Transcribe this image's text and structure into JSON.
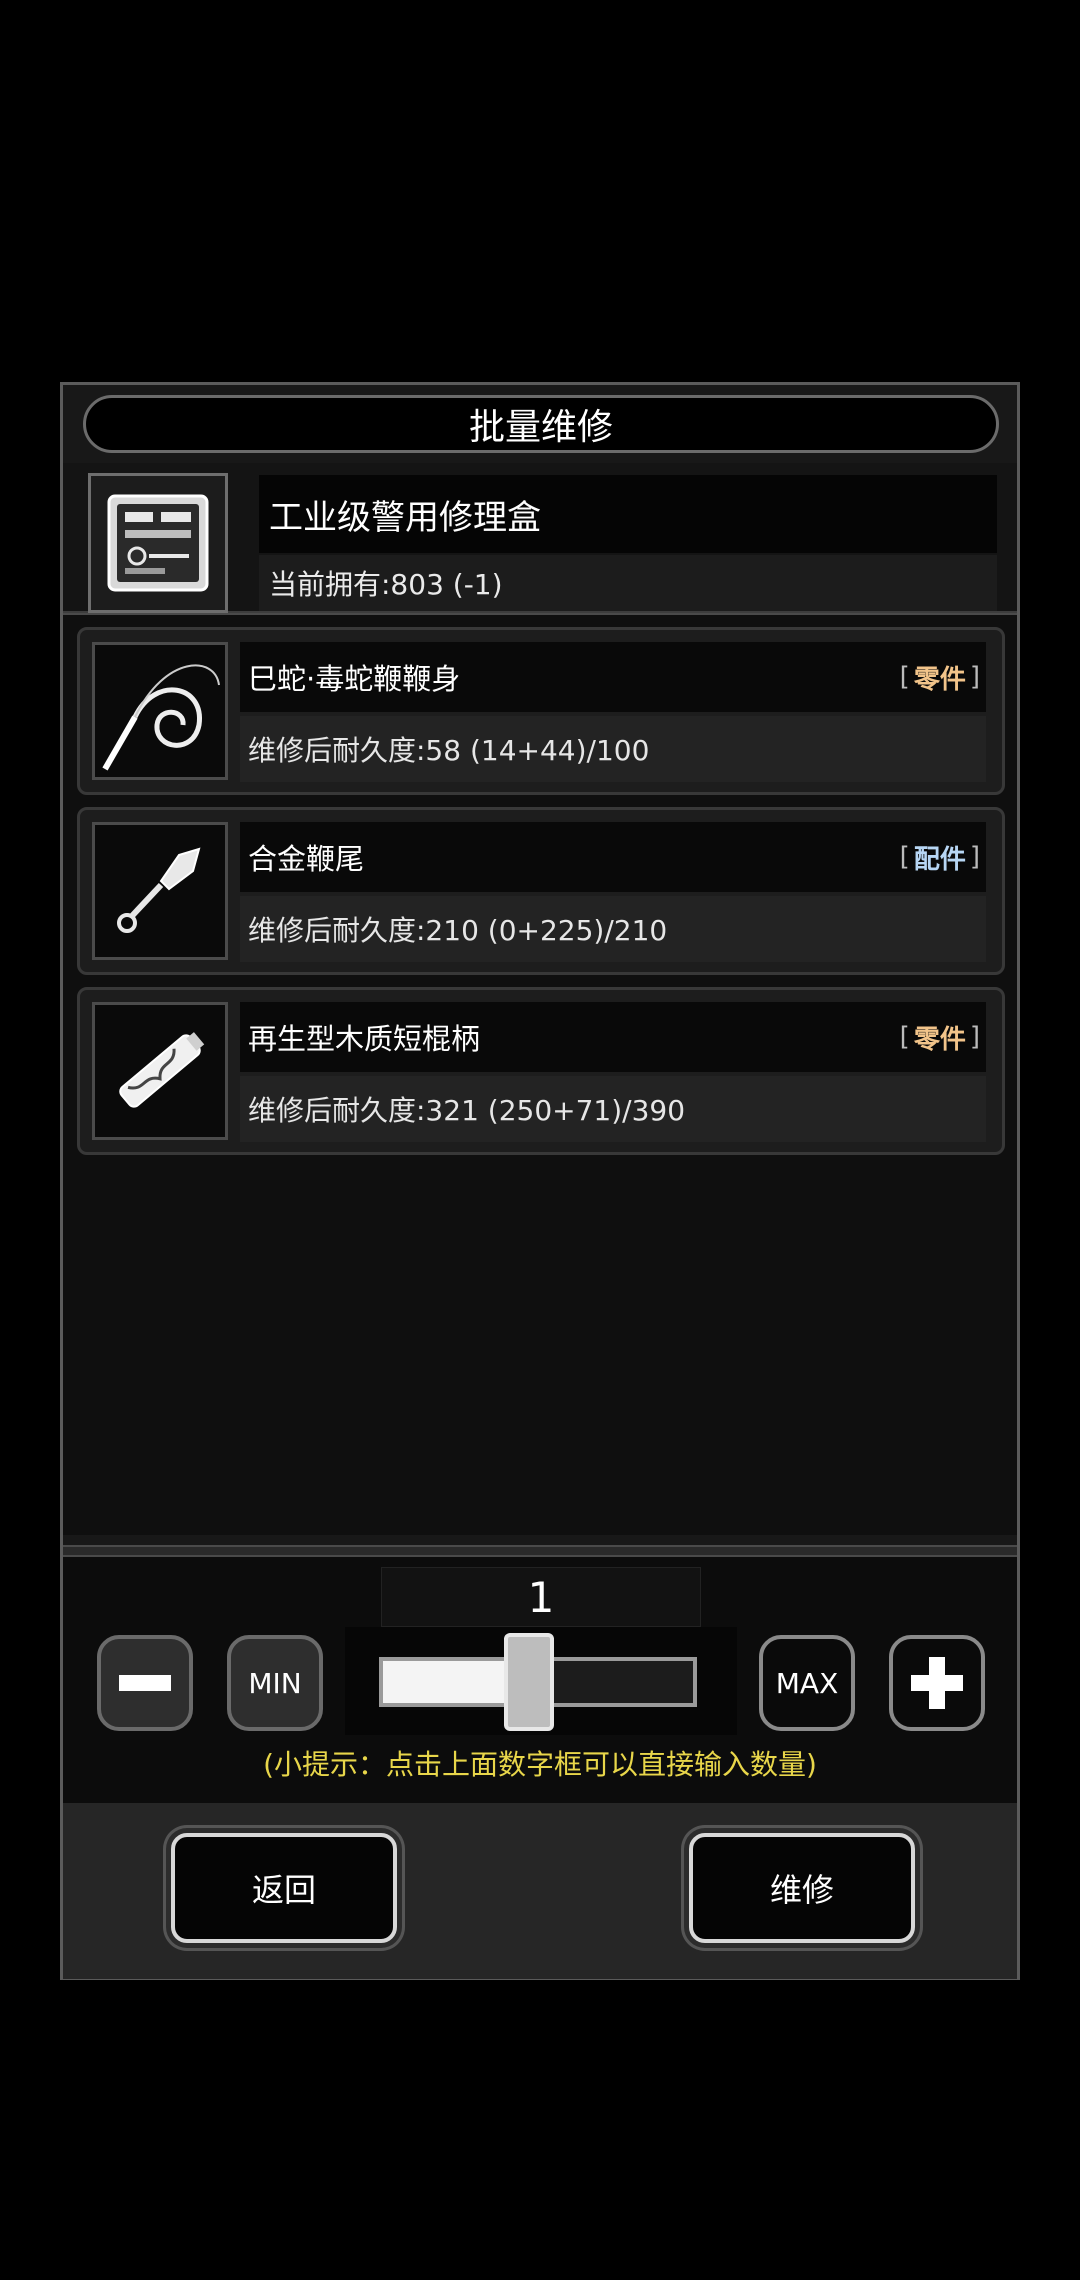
{
  "dialog": {
    "title": "批量维修",
    "kit": {
      "name": "工业级警用修理盒",
      "owned": "当前拥有:803 (-1)",
      "icon": "repair-kit-icon"
    },
    "items": [
      {
        "name": "巳蛇·毒蛇鞭鞭身",
        "tag": "零件",
        "tag_color": "#f2c48a",
        "durability": "维修后耐久度:58 (14+44)/100",
        "icon": "whip-icon"
      },
      {
        "name": "合金鞭尾",
        "tag": "配件",
        "tag_color": "#b7d6f4",
        "durability": "维修后耐久度:210 (0+225)/210",
        "icon": "whip-tail-icon"
      },
      {
        "name": "再生型木质短棍柄",
        "tag": "零件",
        "tag_color": "#f2c48a",
        "durability": "维修后耐久度:321 (250+71)/390",
        "icon": "baton-handle-icon"
      }
    ],
    "tag_bracket_open": "[",
    "tag_bracket_close": "]"
  },
  "controls": {
    "quantity": "1",
    "min_label": "MIN",
    "max_label": "MAX",
    "slider_fraction": 0.41,
    "hint": "(小提示：点击上面数字框可以直接输入数量)"
  },
  "buttons": {
    "back": "返回",
    "repair": "维修"
  }
}
